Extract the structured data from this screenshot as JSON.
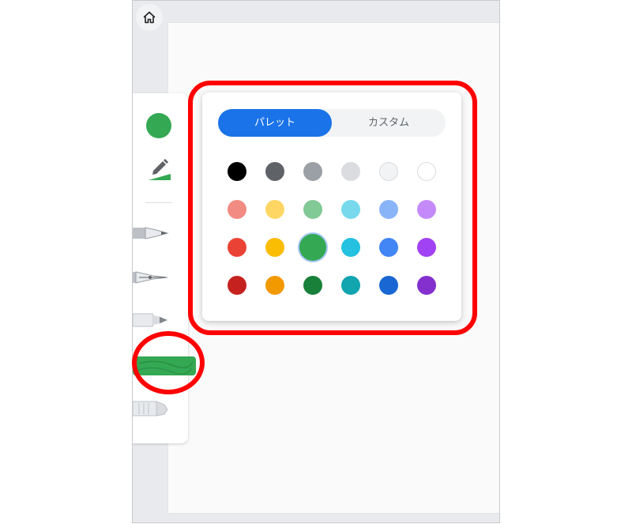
{
  "toolbar": {
    "home_icon": "home-icon",
    "current_color": "#34a853",
    "tools": [
      "pen",
      "fountain-pen",
      "marker",
      "highlighter",
      "eraser"
    ],
    "active_tool": "highlighter"
  },
  "color_popover": {
    "tabs": [
      {
        "label": "パレット",
        "active": true
      },
      {
        "label": "カスタム",
        "active": false
      }
    ],
    "swatch_rows": [
      [
        "#000000",
        "#5f6368",
        "#9aa0a6",
        "#dadce0",
        "#f1f3f4",
        "#ffffff"
      ],
      [
        "#f28b82",
        "#fdd663",
        "#81c995",
        "#78d9ec",
        "#8ab4f8",
        "#c58af9"
      ],
      [
        "#ea4335",
        "#fbbc04",
        "#34a853",
        "#24c1e0",
        "#4285f4",
        "#a142f4"
      ],
      [
        "#c5221f",
        "#f29900",
        "#188038",
        "#12a4af",
        "#1967d2",
        "#8430ce"
      ]
    ],
    "selected_color": "#34a853"
  },
  "colors": {
    "accent": "#1a73e8",
    "annotation": "#ff0000",
    "highlighter": "#34a853"
  }
}
